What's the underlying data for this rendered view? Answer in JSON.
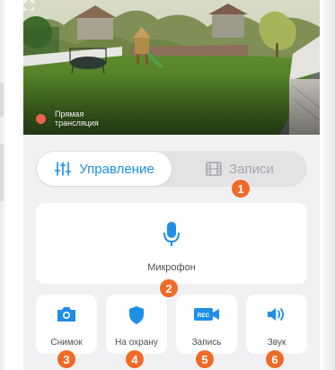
{
  "video": {
    "live_label": "Прямая трансляция",
    "live_color": "#f0614d"
  },
  "tabs": {
    "control": {
      "label": "Управление",
      "icon": "sliders-icon",
      "active": true
    },
    "records": {
      "label": "Записи",
      "icon": "film-icon",
      "active": false
    }
  },
  "microphone": {
    "label": "Микрофон",
    "icon": "microphone-icon"
  },
  "actions": [
    {
      "label": "Снимок",
      "icon": "camera-icon"
    },
    {
      "label": "На охрану",
      "icon": "shield-icon"
    },
    {
      "label": "Запись",
      "icon": "rec-icon",
      "icon_text": "REC"
    },
    {
      "label": "Звук",
      "icon": "speaker-icon"
    }
  ],
  "badges": [
    "1",
    "2",
    "3",
    "4",
    "5",
    "6"
  ],
  "colors": {
    "accent": "#1f8ee6",
    "badge": "#f06a26",
    "inactive_text": "#a4a5aa",
    "background": "#f1f1f3"
  }
}
